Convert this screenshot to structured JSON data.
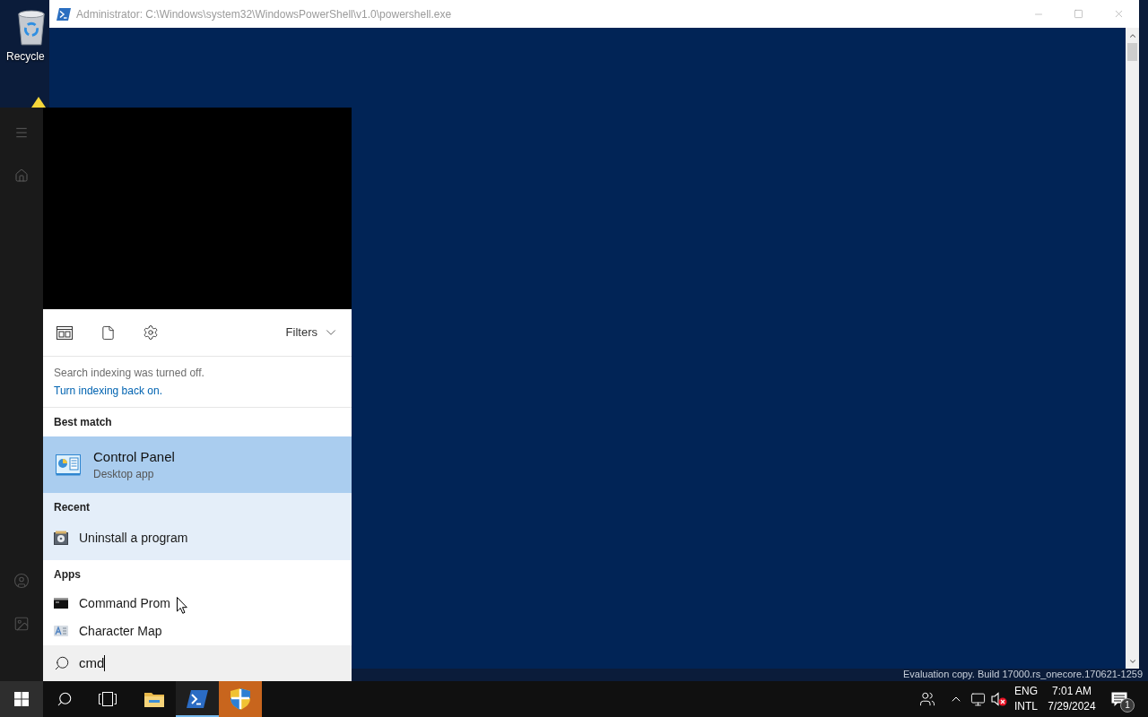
{
  "desktop": {
    "icons": [
      {
        "label": "Recycle"
      }
    ],
    "watermark": "Evaluation copy. Build 17000.rs_onecore.170621-1259"
  },
  "window": {
    "title": "Administrator: C:\\Windows\\system32\\WindowsPowerShell\\v1.0\\powershell.exe"
  },
  "start_menu": {
    "filters": "Filters",
    "notice": {
      "text": "Search indexing was turned off.",
      "link": "Turn indexing back on."
    },
    "sections": [
      {
        "heading": "Best match",
        "highlighted": false,
        "items": [
          {
            "kind": "control-panel",
            "title": "Control Panel",
            "subtitle": "Desktop app",
            "selected": true
          }
        ]
      },
      {
        "heading": "Recent",
        "highlighted": true,
        "items": [
          {
            "kind": "uninstall",
            "title": "Uninstall a program",
            "selected": false
          }
        ]
      },
      {
        "heading": "Apps",
        "highlighted": false,
        "items": [
          {
            "kind": "console",
            "title": "Command Prom",
            "selected": false
          },
          {
            "kind": "charmap",
            "title": "Character Map",
            "selected": false
          }
        ]
      }
    ],
    "search": {
      "value": "cmd"
    }
  },
  "taskbar": {
    "start": {
      "selected": true
    },
    "apps": [
      {
        "kind": "explorer",
        "active": false,
        "flashing": false
      },
      {
        "kind": "powershell",
        "active": true,
        "flashing": false
      },
      {
        "kind": "shield",
        "active": false,
        "flashing": true
      }
    ],
    "tray": {
      "volume_muted": true,
      "language": [
        "ENG",
        "INTL"
      ],
      "time": "7:01 AM",
      "date": "7/29/2024",
      "notifications": "1"
    }
  }
}
